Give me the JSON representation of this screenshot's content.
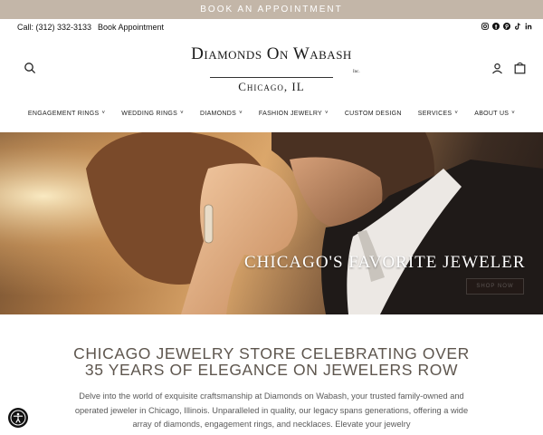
{
  "announcement": {
    "text": "BOOK AN APPOINTMENT"
  },
  "utility": {
    "phone": "Call: (312) 332-3133",
    "book_link": "Book Appointment",
    "socials": [
      "instagram-icon",
      "facebook-icon",
      "pinterest-icon",
      "tiktok-icon",
      "linkedin-icon"
    ]
  },
  "header": {
    "logo_main": "Diamonds On Wabash",
    "logo_inc": "Inc.",
    "logo_sub": "Chicago, IL",
    "icons": [
      "search-icon",
      "account-icon",
      "cart-icon"
    ]
  },
  "nav": {
    "items": [
      {
        "label": "ENGAGEMENT RINGS",
        "dropdown": true
      },
      {
        "label": "WEDDING RINGS",
        "dropdown": true
      },
      {
        "label": "DIAMONDS",
        "dropdown": true
      },
      {
        "label": "FASHION JEWELRY",
        "dropdown": true
      },
      {
        "label": "CUSTOM DESIGN",
        "dropdown": false
      },
      {
        "label": "SERVICES",
        "dropdown": true
      },
      {
        "label": "ABOUT US",
        "dropdown": true
      }
    ],
    "chevron": "˅"
  },
  "hero": {
    "title": "CHICAGO'S FAVORITE JEWELER",
    "cta": "SHOP NOW"
  },
  "intro": {
    "title_line1": "CHICAGO JEWELRY STORE CELEBRATING OVER",
    "title_line2": "35 YEARS OF ELEGANCE ON JEWELERS ROW",
    "body": "Delve into the world of exquisite craftsmanship at Diamonds on Wabash, your trusted family-owned and operated jeweler in Chicago, Illinois. Unparalleled in quality, our legacy spans generations, offering a wide array of diamonds, engagement rings, and necklaces. Elevate your jewelry"
  },
  "accessibility": {
    "icon": "accessibility-icon"
  },
  "colors": {
    "announce_bg": "#c3b6a8",
    "heading": "#5e564e"
  }
}
